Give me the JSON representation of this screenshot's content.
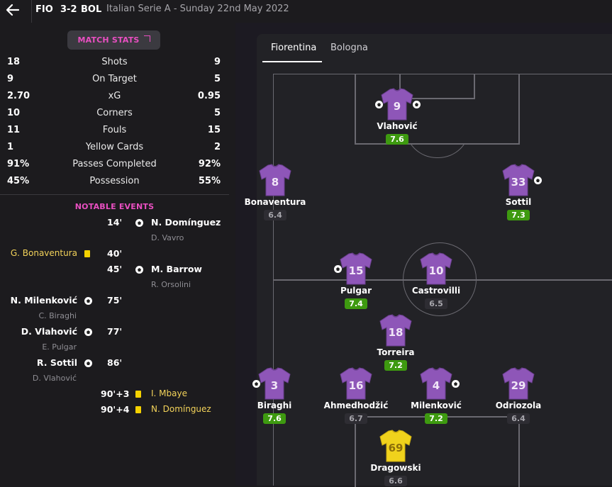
{
  "header": {
    "home_code": "FIO",
    "score": "3-2",
    "away_code": "BOL",
    "match_info": "Italian Serie A  -  Sunday 22nd May 2022"
  },
  "match_stats_button": "MATCH STATS",
  "stats": [
    {
      "home": "18",
      "label": "Shots",
      "away": "9"
    },
    {
      "home": "9",
      "label": "On Target",
      "away": "5"
    },
    {
      "home": "2.70",
      "label": "xG",
      "away": "0.95"
    },
    {
      "home": "10",
      "label": "Corners",
      "away": "5"
    },
    {
      "home": "11",
      "label": "Fouls",
      "away": "15"
    },
    {
      "home": "1",
      "label": "Yellow Cards",
      "away": "2"
    },
    {
      "home": "91%",
      "label": "Passes Completed",
      "away": "92%"
    },
    {
      "home": "45%",
      "label": "Possession",
      "away": "55%"
    }
  ],
  "notable_events_title": "NOTABLE EVENTS",
  "events": [
    {
      "time": "14'",
      "side": "away",
      "type": "goal",
      "player": "N. Domínguez",
      "assist": "D. Vavro"
    },
    {
      "time": "40'",
      "side": "home",
      "type": "yellow",
      "player": "G. Bonaventura",
      "assist": ""
    },
    {
      "time": "45'",
      "side": "away",
      "type": "goal",
      "player": "M. Barrow",
      "assist": "R. Orsolini"
    },
    {
      "time": "75'",
      "side": "home",
      "type": "goal",
      "player": "N. Milenković",
      "assist": "C. Biraghi"
    },
    {
      "time": "77'",
      "side": "home",
      "type": "goal",
      "player": "D. Vlahović",
      "assist": "E. Pulgar"
    },
    {
      "time": "86'",
      "side": "home",
      "type": "goal",
      "player": "R. Sottil",
      "assist": "D. Vlahović"
    },
    {
      "time": "90'+3",
      "side": "away",
      "type": "yellow",
      "player": "I. Mbaye",
      "assist": ""
    },
    {
      "time": "90'+4",
      "side": "away",
      "type": "yellow",
      "player": "N. Domínguez",
      "assist": ""
    }
  ],
  "tabs": [
    "Fiorentina",
    "Bologna"
  ],
  "active_tab": "Fiorentina",
  "colors": {
    "accent": "#e94fc1",
    "outfield_shirt": "#8e56b8",
    "keeper_shirt": "#f0d21c",
    "good_rating": "#3e9a10"
  },
  "lineup": [
    {
      "number": "9",
      "name": "Vlahović",
      "rating": "7.6",
      "good": true,
      "goal_left": true,
      "goal_right": true
    },
    {
      "number": "8",
      "name": "Bonaventura",
      "rating": "6.4",
      "good": false
    },
    {
      "number": "33",
      "name": "Sottil",
      "rating": "7.3",
      "good": true,
      "goal_right": true
    },
    {
      "number": "15",
      "name": "Pulgar",
      "rating": "7.4",
      "good": true,
      "goal_left": true
    },
    {
      "number": "10",
      "name": "Castrovilli",
      "rating": "6.5",
      "good": false
    },
    {
      "number": "18",
      "name": "Torreira",
      "rating": "7.2",
      "good": true
    },
    {
      "number": "3",
      "name": "Biraghi",
      "rating": "7.6",
      "good": true,
      "goal_left": true
    },
    {
      "number": "16",
      "name": "Ahmedhodžić",
      "rating": "6.7",
      "good": false
    },
    {
      "number": "4",
      "name": "Milenković",
      "rating": "7.2",
      "good": true,
      "goal_right": true
    },
    {
      "number": "29",
      "name": "Odriozola",
      "rating": "6.4",
      "good": false
    },
    {
      "number": "69",
      "name": "Dragowski",
      "rating": "6.6",
      "good": false,
      "keeper": true
    }
  ]
}
